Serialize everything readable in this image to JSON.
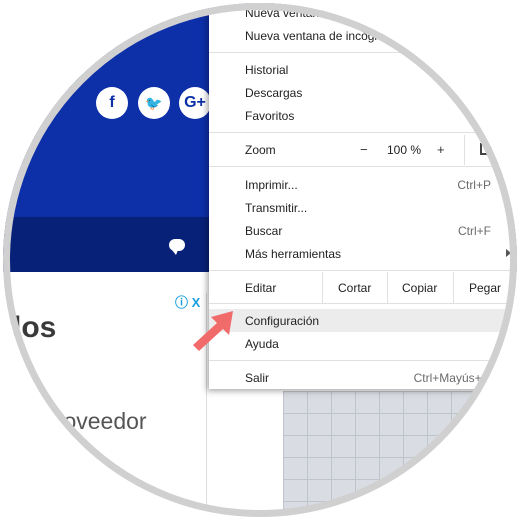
{
  "page": {
    "social": [
      "f",
      "🐦",
      "G+"
    ],
    "adchoice": "ⓘ X",
    "heading": "dos",
    "body_text": "proveedor"
  },
  "menu": {
    "items_top": [
      {
        "label": "Nueva ventana"
      },
      {
        "label": "Nueva ventana de incógnito"
      }
    ],
    "items_history": [
      {
        "label": "Historial"
      },
      {
        "label": "Descargas"
      },
      {
        "label": "Favoritos"
      }
    ],
    "zoom": {
      "label": "Zoom",
      "minus": "−",
      "value": "100 %",
      "plus": "+"
    },
    "items_tools": [
      {
        "label": "Imprimir...",
        "shortcut": "Ctrl+P"
      },
      {
        "label": "Transmitir..."
      },
      {
        "label": "Buscar",
        "shortcut": "Ctrl+F"
      },
      {
        "label": "Más herramientas"
      }
    ],
    "edit": {
      "label": "Editar",
      "cut": "Cortar",
      "copy": "Copiar",
      "paste": "Pegar"
    },
    "items_settings": [
      {
        "label": "Configuración"
      },
      {
        "label": "Ayuda"
      }
    ],
    "exit": {
      "label": "Salir",
      "shortcut": "Ctrl+Mayús+Q"
    }
  },
  "colors": {
    "header_blue": "#0d2fa8",
    "nav_blue": "#072178",
    "pointer": "#f26b6b",
    "highlight": "#ececec"
  }
}
